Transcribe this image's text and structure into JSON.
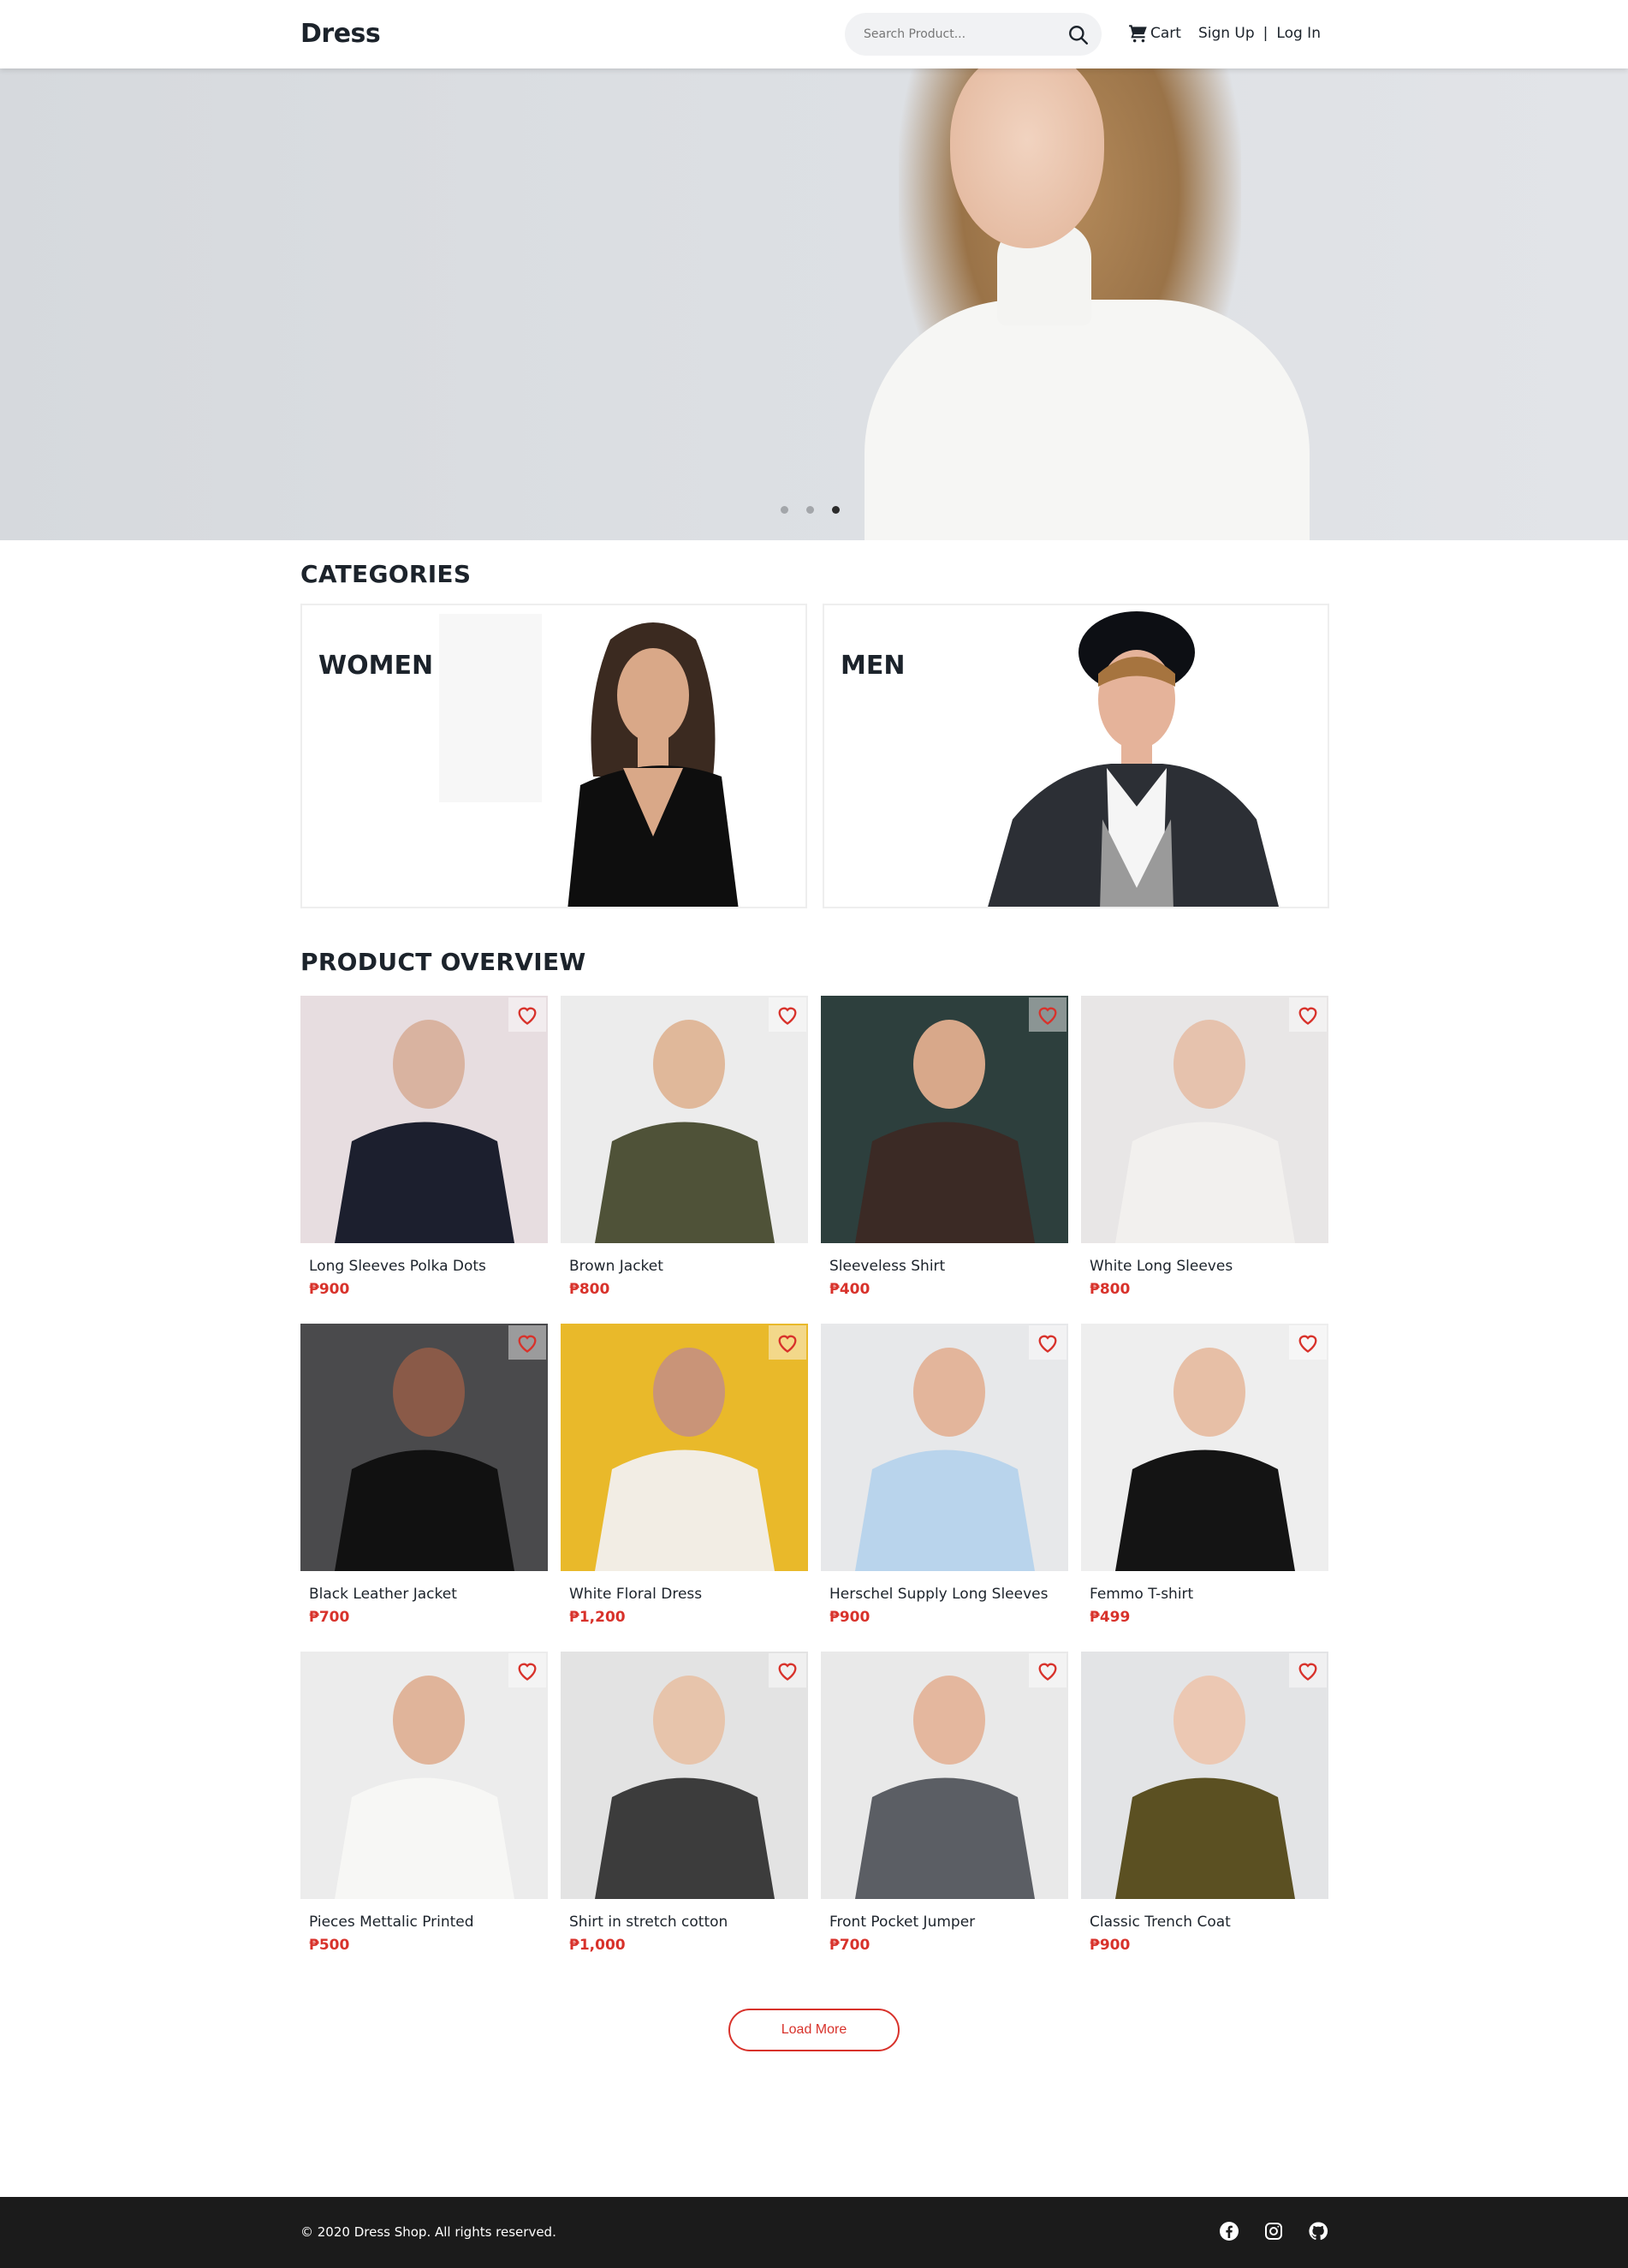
{
  "header": {
    "brand": "Dress",
    "search_placeholder": "Search Product...",
    "cart_label": "Cart",
    "signup_label": "Sign Up",
    "separator": "|",
    "login_label": "Log In"
  },
  "hero": {
    "slides_total": 3,
    "active_slide": 3
  },
  "categories": {
    "title": "CATEGORIES",
    "items": [
      {
        "label": "WOMEN"
      },
      {
        "label": "MEN"
      }
    ]
  },
  "products": {
    "title": "PRODUCT OVERVIEW",
    "currency_symbol": "₱",
    "items": [
      {
        "name": "Long Sleeves Polka Dots",
        "price": "₱900"
      },
      {
        "name": "Brown Jacket",
        "price": "₱800"
      },
      {
        "name": "Sleeveless Shirt",
        "price": "₱400"
      },
      {
        "name": "White Long Sleeves",
        "price": "₱800"
      },
      {
        "name": "Black Leather Jacket",
        "price": "₱700"
      },
      {
        "name": "White Floral Dress",
        "price": "₱1,200"
      },
      {
        "name": "Herschel Supply Long Sleeves",
        "price": "₱900"
      },
      {
        "name": "Femmo T-shirt",
        "price": "₱499"
      },
      {
        "name": "Pieces Mettalic Printed",
        "price": "₱500"
      },
      {
        "name": "Shirt in stretch cotton",
        "price": "₱1,000"
      },
      {
        "name": "Front Pocket Jumper",
        "price": "₱700"
      },
      {
        "name": "Classic Trench Coat",
        "price": "₱900"
      }
    ],
    "load_more_label": "Load More"
  },
  "footer": {
    "copyright": "© 2020 Dress Shop. All rights reserved.",
    "social": [
      "facebook-icon",
      "instagram-icon",
      "github-icon"
    ]
  },
  "colors": {
    "accent": "#d8322b",
    "text": "#1c232b",
    "footer_bg": "#1b1b1b",
    "search_bg": "#f1f2f4"
  }
}
